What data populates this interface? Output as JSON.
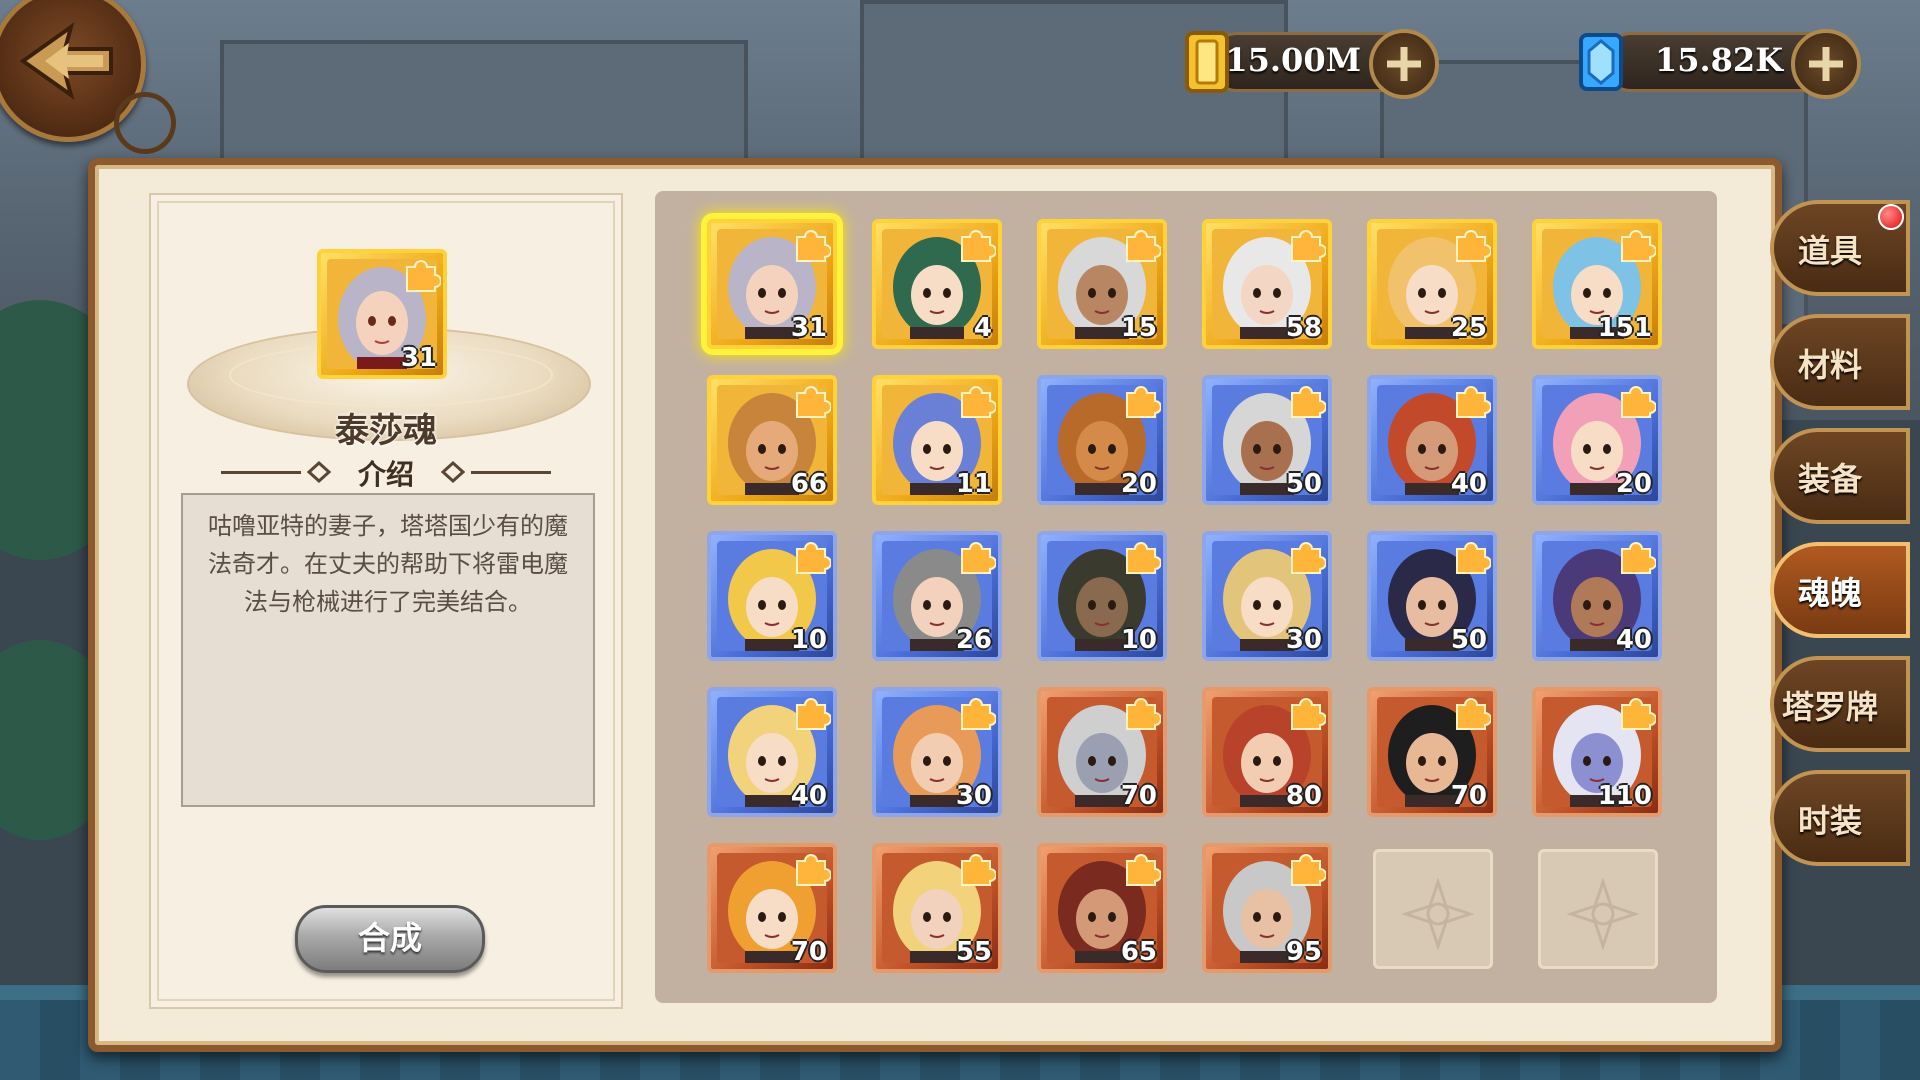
{
  "currency": {
    "gold": {
      "value": "15.00M",
      "icon": "gold-bar-icon",
      "color": "#f0b21a"
    },
    "diamond": {
      "value": "15.82K",
      "icon": "diamond-icon",
      "color": "#36a8ff"
    }
  },
  "selected": {
    "name": "泰莎魂",
    "count": "31",
    "intro_title": "介绍",
    "description": "咕噜亚特的妻子，塔塔国少有的魔法奇才。在丈夫的帮助下将雷电魔法与枪械进行了完美结合。",
    "synthesize_label": "合成"
  },
  "souls": [
    {
      "count": "31",
      "rarity": "gold",
      "selected": true,
      "hair": "#b9b4c8",
      "skin": "#f5d2bd"
    },
    {
      "count": "4",
      "rarity": "gold",
      "hair": "#2f6a4f",
      "skin": "#f7dcc6"
    },
    {
      "count": "15",
      "rarity": "gold",
      "hair": "#d8d8d8",
      "skin": "#b98664"
    },
    {
      "count": "58",
      "rarity": "gold",
      "hair": "#e8e8e8",
      "skin": "#f4d6c4"
    },
    {
      "count": "25",
      "rarity": "gold",
      "hair": "#f1c16c",
      "skin": "#f7dcc6"
    },
    {
      "count": "151",
      "rarity": "gold",
      "hair": "#7ec2e6",
      "skin": "#f7dcc6"
    },
    {
      "count": "66",
      "rarity": "gold",
      "hair": "#c8843a",
      "skin": "#e6a97a"
    },
    {
      "count": "11",
      "rarity": "gold",
      "hair": "#6a7fd6",
      "skin": "#f7dcc6"
    },
    {
      "count": "20",
      "rarity": "blue",
      "hair": "#b86a2a",
      "skin": "#d48a48"
    },
    {
      "count": "50",
      "rarity": "blue",
      "hair": "#d6d6d6",
      "skin": "#a8704e"
    },
    {
      "count": "40",
      "rarity": "blue",
      "hair": "#c2492a",
      "skin": "#d59b78"
    },
    {
      "count": "20",
      "rarity": "blue",
      "hair": "#f2a0b8",
      "skin": "#f7dcc6"
    },
    {
      "count": "10",
      "rarity": "blue",
      "hair": "#f2c84a",
      "skin": "#f7dcc6"
    },
    {
      "count": "26",
      "rarity": "blue",
      "hair": "#8a8a8a",
      "skin": "#f2d2bd"
    },
    {
      "count": "10",
      "rarity": "blue",
      "hair": "#3a3a2e",
      "skin": "#8a6a4e"
    },
    {
      "count": "30",
      "rarity": "blue",
      "hair": "#e2c47a",
      "skin": "#f7dcc6"
    },
    {
      "count": "50",
      "rarity": "blue",
      "hair": "#2a2a48",
      "skin": "#e8bca0"
    },
    {
      "count": "40",
      "rarity": "blue",
      "hair": "#4a3a7a",
      "skin": "#b07a58"
    },
    {
      "count": "40",
      "rarity": "blue",
      "hair": "#f2d27a",
      "skin": "#f7dcc6"
    },
    {
      "count": "30",
      "rarity": "blue",
      "hair": "#e89a58",
      "skin": "#f2cdb2"
    },
    {
      "count": "70",
      "rarity": "red",
      "hair": "#cfcfcf",
      "skin": "#9aa0b2"
    },
    {
      "count": "80",
      "rarity": "red",
      "hair": "#b8432a",
      "skin": "#f2cdb2"
    },
    {
      "count": "70",
      "rarity": "red",
      "hair": "#1e1e1e",
      "skin": "#e8b894"
    },
    {
      "count": "110",
      "rarity": "red",
      "hair": "#e4e4f2",
      "skin": "#8c90d2"
    },
    {
      "count": "70",
      "rarity": "red",
      "hair": "#f0a030",
      "skin": "#f7dcc6"
    },
    {
      "count": "55",
      "rarity": "red",
      "hair": "#f2d27a",
      "skin": "#f2d2bd"
    },
    {
      "count": "65",
      "rarity": "red",
      "hair": "#7a2a1e",
      "skin": "#d49a78"
    },
    {
      "count": "95",
      "rarity": "red",
      "hair": "#c8c8c8",
      "skin": "#e8c0a4"
    },
    {
      "empty": true
    },
    {
      "empty": true
    }
  ],
  "tabs": [
    {
      "label": "道具",
      "active": false,
      "notify": true
    },
    {
      "label": "材料",
      "active": false
    },
    {
      "label": "装备",
      "active": false
    },
    {
      "label": "魂魄",
      "active": true
    },
    {
      "label": "塔罗牌",
      "active": false
    },
    {
      "label": "时装",
      "active": false
    }
  ]
}
